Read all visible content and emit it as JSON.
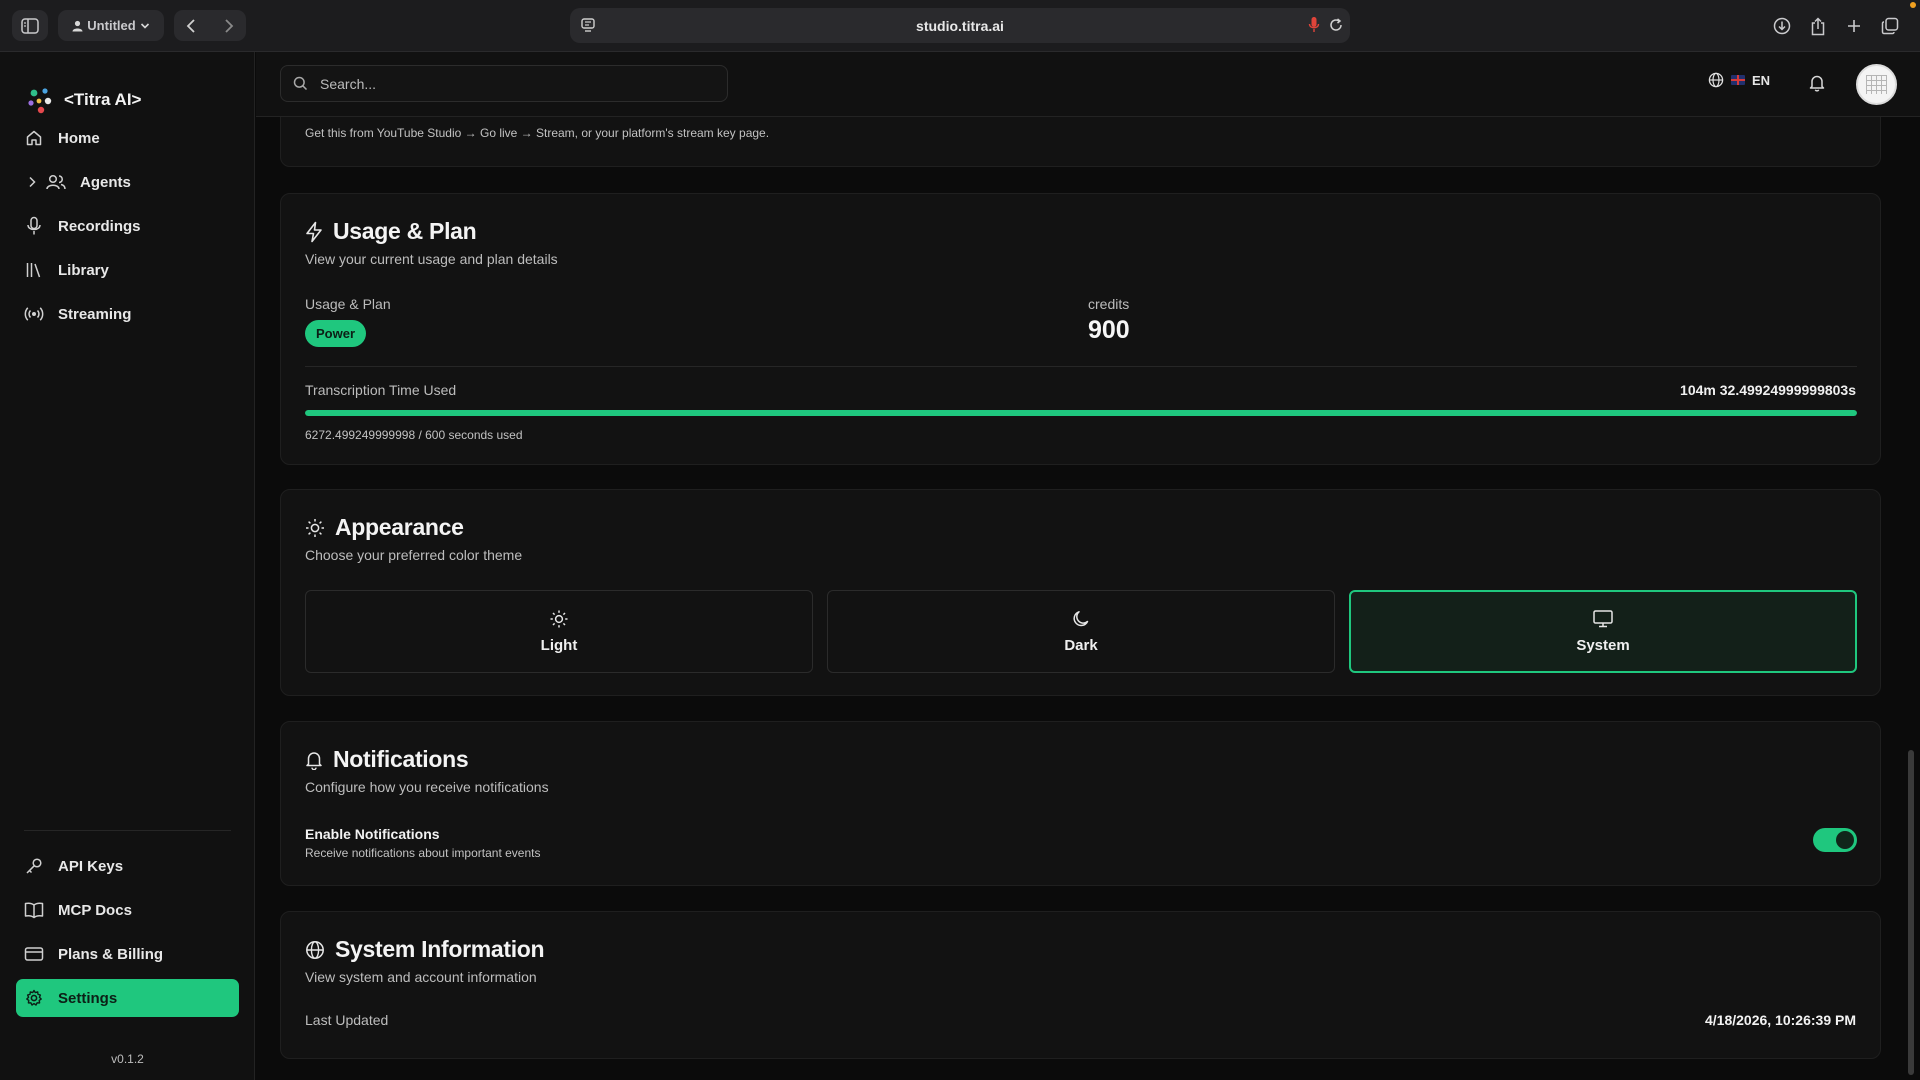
{
  "browser": {
    "profile_label": "Untitled",
    "url": "studio.titra.ai"
  },
  "sidebar": {
    "brand": "<Titra AI>",
    "items": [
      {
        "label": "Home",
        "icon": "home-icon"
      },
      {
        "label": "Agents",
        "icon": "users-icon"
      },
      {
        "label": "Recordings",
        "icon": "mic-icon"
      },
      {
        "label": "Library",
        "icon": "library-icon"
      },
      {
        "label": "Streaming",
        "icon": "broadcast-icon"
      }
    ],
    "bottom_items": [
      {
        "label": "API Keys",
        "icon": "key-icon"
      },
      {
        "label": "MCP Docs",
        "icon": "book-icon"
      },
      {
        "label": "Plans & Billing",
        "icon": "credit-card-icon"
      },
      {
        "label": "Settings",
        "icon": "gear-icon",
        "active": true
      }
    ],
    "version": "v0.1.2"
  },
  "topbar": {
    "search_placeholder": "Search...",
    "language": "EN"
  },
  "stream_hint": "Get this from YouTube Studio → Go live → Stream, or your platform's stream key page.",
  "usage": {
    "title": "Usage & Plan",
    "subtitle": "View your current usage and plan details",
    "plan_label": "Usage & Plan",
    "plan_badge": "Power",
    "credits_label": "credits",
    "credits_value": "900",
    "time_label": "Transcription Time Used",
    "time_value": "104m 32.49924999999803s",
    "time_detail": "6272.499249999998 / 600 seconds used",
    "progress_fraction": 1.0
  },
  "appearance": {
    "title": "Appearance",
    "subtitle": "Choose your preferred color theme",
    "options": [
      {
        "label": "Light",
        "icon": "sun-icon"
      },
      {
        "label": "Dark",
        "icon": "moon-icon"
      },
      {
        "label": "System",
        "icon": "monitor-icon",
        "selected": true
      }
    ]
  },
  "notifications": {
    "title": "Notifications",
    "subtitle": "Configure how you receive notifications",
    "setting_title": "Enable Notifications",
    "setting_desc": "Receive notifications about important events",
    "enabled": true
  },
  "system": {
    "title": "System Information",
    "subtitle": "View system and account information",
    "last_updated_label": "Last Updated",
    "last_updated_value": "4/18/2026, 10:26:39 PM"
  },
  "colors": {
    "accent": "#1fc77e",
    "background": "#0b0b0b",
    "card": "#121212",
    "sidebar": "#111111"
  }
}
